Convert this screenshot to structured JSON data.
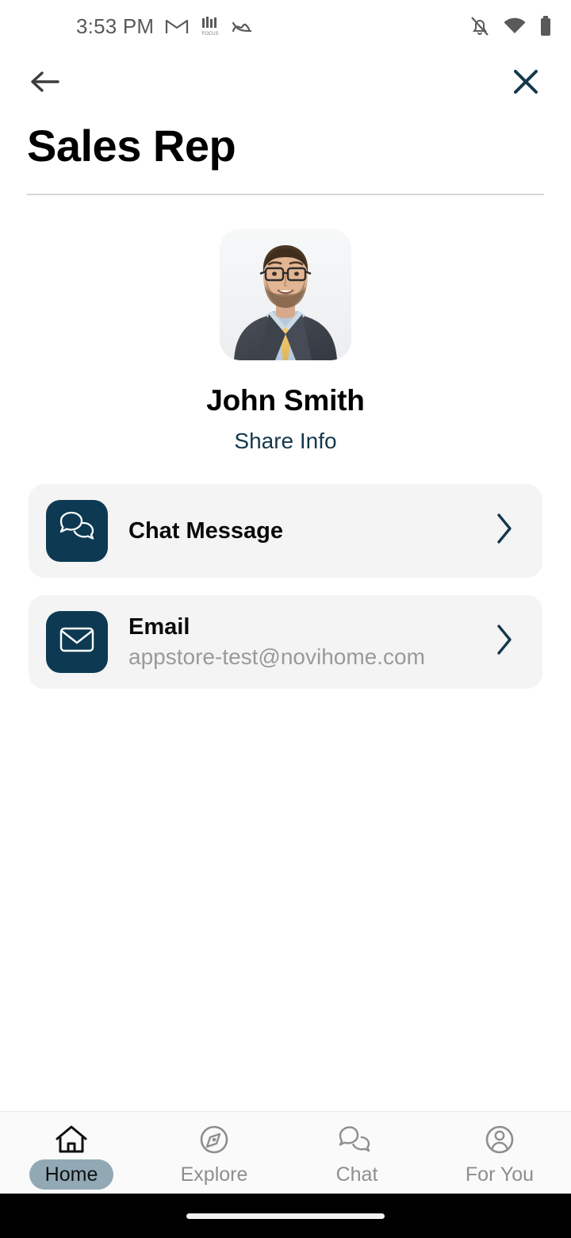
{
  "statusbar": {
    "time": "3:53 PM",
    "left_icons": [
      {
        "name": "gmail-icon",
        "label": "Gmail"
      },
      {
        "name": "focus-icon",
        "label": "FOCUS"
      },
      {
        "name": "activity-waves-icon",
        "label": "Activity"
      }
    ],
    "right_icons": [
      {
        "name": "notifications-off-icon",
        "label": "Notifications off"
      },
      {
        "name": "wifi-icon",
        "label": "Wi-Fi"
      },
      {
        "name": "battery-full-icon",
        "label": "Battery full"
      }
    ]
  },
  "appbar": {
    "back_label": "Back",
    "close_label": "Close"
  },
  "header": {
    "title": "Sales Rep"
  },
  "profile": {
    "name": "John Smith",
    "share_label": "Share Info",
    "avatar_alt": "John Smith headshot"
  },
  "actions": [
    {
      "icon": "chat-bubbles-icon",
      "title": "Chat Message",
      "subtitle": "",
      "chevron": "chevron-right-icon"
    },
    {
      "icon": "envelope-icon",
      "title": "Email",
      "subtitle": "appstore-test@novihome.com",
      "chevron": "chevron-right-icon"
    }
  ],
  "bottom_nav": {
    "active_index": 0,
    "items": [
      {
        "icon": "home-icon",
        "label": "Home"
      },
      {
        "icon": "compass-icon",
        "label": "Explore"
      },
      {
        "icon": "chat-icon",
        "label": "Chat"
      },
      {
        "icon": "person-circle-icon",
        "label": "For You"
      }
    ]
  },
  "colors": {
    "tile_navy": "#0d3a52",
    "link_teal": "#14384c",
    "card_bg": "#f4f4f4",
    "active_pill": "#92a9b5",
    "subtitle_gray": "#9a9a9a"
  }
}
